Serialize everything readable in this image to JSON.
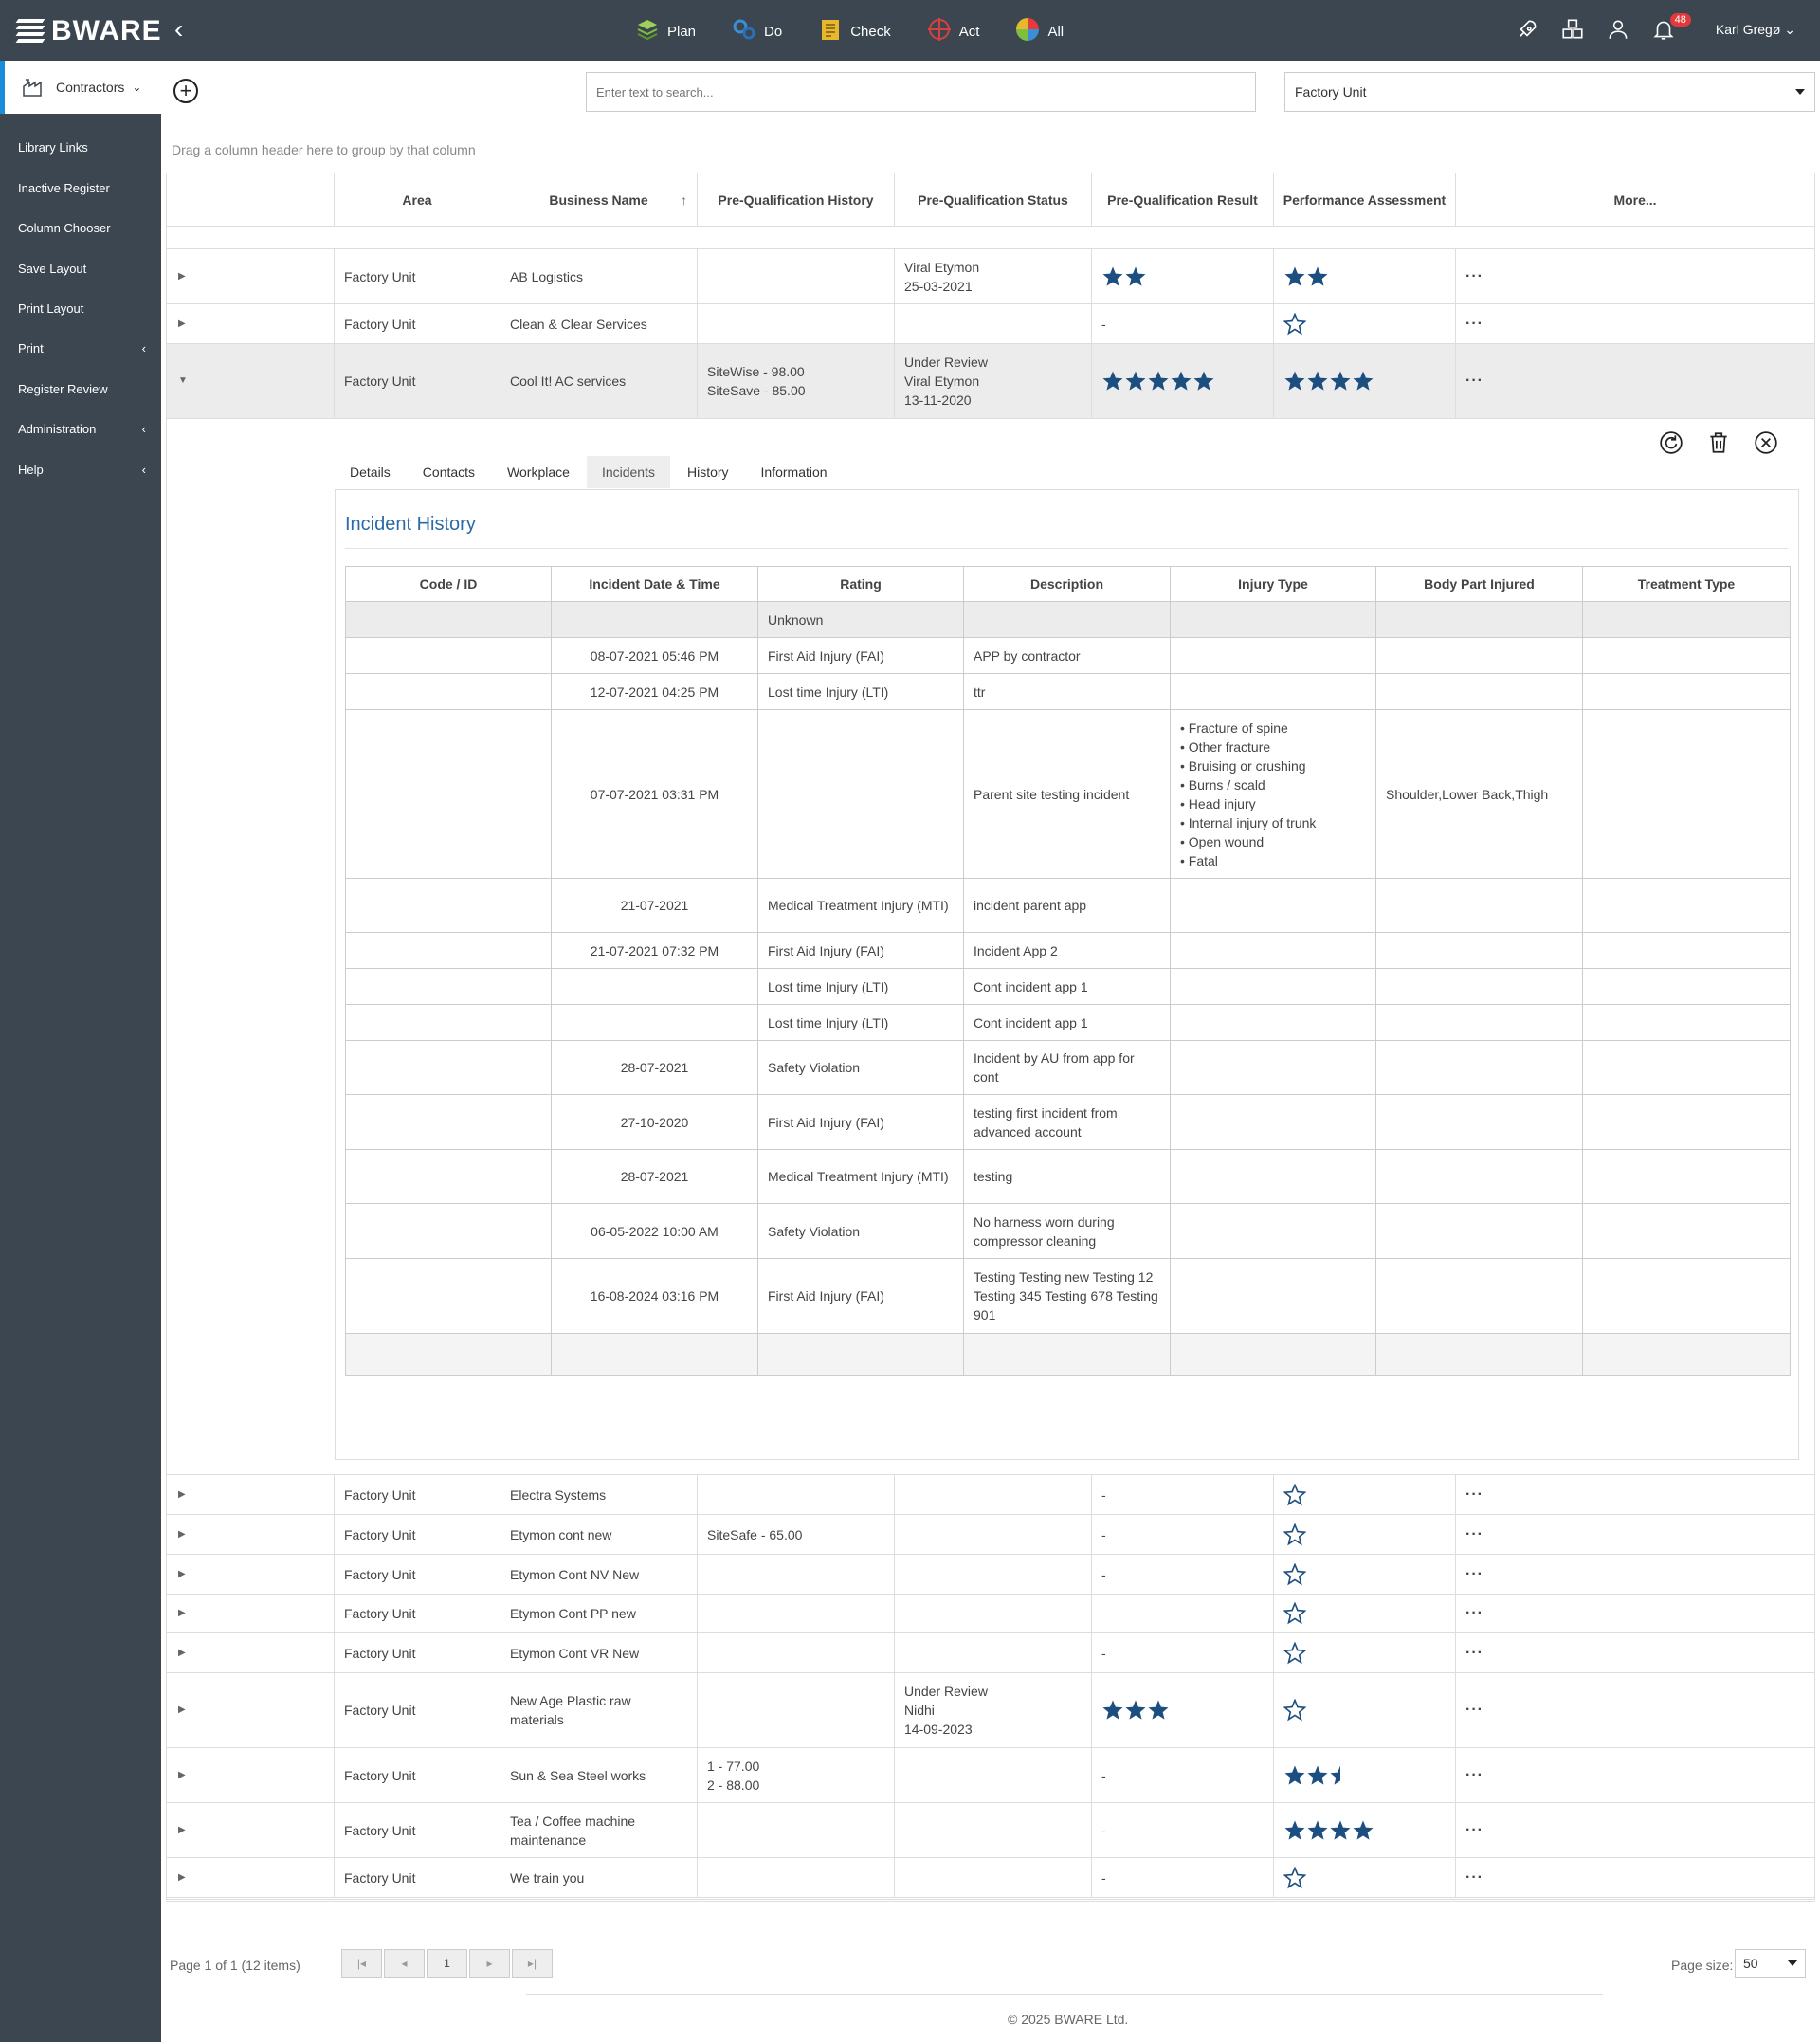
{
  "app": {
    "brand": "BWARE"
  },
  "topnav": {
    "items": [
      {
        "label": "Plan",
        "icon": "plan-icon",
        "color": "#7fbf3f"
      },
      {
        "label": "Do",
        "icon": "do-icon",
        "color": "#3a8fd6"
      },
      {
        "label": "Check",
        "icon": "check-icon",
        "color": "#e6b82e"
      },
      {
        "label": "Act",
        "icon": "act-icon",
        "color": "#d64040"
      },
      {
        "label": "All",
        "icon": "all-icon",
        "color": "#e63a3a"
      }
    ],
    "notifications_count": "48",
    "user_name": "Karl Gregø"
  },
  "sidebar": {
    "active": {
      "label": "Contractors"
    },
    "items": [
      {
        "label": "Library Links",
        "chevron": ""
      },
      {
        "label": "Inactive Register",
        "chevron": ""
      },
      {
        "label": "Column Chooser",
        "chevron": ""
      },
      {
        "label": "Save Layout",
        "chevron": ""
      },
      {
        "label": "Print Layout",
        "chevron": ""
      },
      {
        "label": "Print",
        "chevron": "‹"
      },
      {
        "label": "Register Review",
        "chevron": ""
      },
      {
        "label": "Administration",
        "chevron": "‹"
      },
      {
        "label": "Help",
        "chevron": "‹"
      }
    ]
  },
  "toolbar": {
    "search_placeholder": "Enter text to search...",
    "area_selected": "Factory Unit",
    "group_hint": "Drag a column header here to group by that column"
  },
  "grid": {
    "headers": [
      "",
      "Area",
      "Business Name",
      "Pre-Qualification History",
      "Pre-Qualification Status",
      "Pre-Qualification Result",
      "Performance Assessment",
      "More..."
    ],
    "sort_icon": "↑",
    "rows": [
      {
        "area": "Factory Unit",
        "business": "AB Logistics",
        "history": [],
        "status": [
          "Viral Etymon",
          "25-03-2021"
        ],
        "result_stars": 2,
        "result_text": "",
        "perf_stars": 2,
        "expanded": false
      },
      {
        "area": "Factory Unit",
        "business": "Clean & Clear Services",
        "history": [],
        "status": [],
        "result_stars": 0,
        "result_text": "-",
        "perf_stars": 0,
        "expanded": false
      },
      {
        "area": "Factory Unit",
        "business": "Cool It! AC services",
        "history": [
          "SiteWise - 98.00",
          "SiteSave - 85.00"
        ],
        "status": [
          "Under Review",
          "Viral Etymon",
          "13-11-2020"
        ],
        "result_stars": 5,
        "result_text": "",
        "perf_stars": 4,
        "expanded": true
      }
    ],
    "rows_after": [
      {
        "area": "Factory Unit",
        "business": [
          "Electra Systems"
        ],
        "history": [],
        "status": [],
        "result_stars": 0,
        "result_text": "-",
        "perf_stars": 0,
        "perf_empty": true
      },
      {
        "area": "Factory Unit",
        "business": [
          "Etymon cont new"
        ],
        "history": [
          "SiteSafe - 65.00"
        ],
        "status": [],
        "result_stars": 0,
        "result_text": "-",
        "perf_stars": 0,
        "perf_empty": true
      },
      {
        "area": "Factory Unit",
        "business": [
          "Etymon Cont NV New"
        ],
        "history": [],
        "status": [],
        "result_stars": 0,
        "result_text": "-",
        "perf_stars": 0,
        "perf_empty": true
      },
      {
        "area": "Factory Unit",
        "business": [
          "Etymon Cont PP new"
        ],
        "history": [],
        "status": [],
        "result_stars": 0,
        "result_text": "",
        "perf_stars": 0,
        "perf_empty": true
      },
      {
        "area": "Factory Unit",
        "business": [
          "Etymon Cont VR New"
        ],
        "history": [],
        "status": [],
        "result_stars": 0,
        "result_text": "-",
        "perf_stars": 0,
        "perf_empty": true
      },
      {
        "area": "Factory Unit",
        "business": [
          "New Age Plastic raw",
          "materials"
        ],
        "history": [],
        "status": [
          "Under Review",
          "Nidhi",
          "14-09-2023"
        ],
        "result_stars": 3,
        "result_text": "",
        "perf_stars": 0,
        "perf_empty": true
      },
      {
        "area": "Factory Unit",
        "business": [
          "Sun & Sea Steel works"
        ],
        "history": [
          "1 - 77.00",
          "2 - 88.00"
        ],
        "status": [],
        "result_stars": 0,
        "result_text": "-",
        "perf_stars": 2.5,
        "perf_empty": false
      },
      {
        "area": "Factory Unit",
        "business": [
          "Tea / Coffee machine",
          "maintenance"
        ],
        "history": [],
        "status": [],
        "result_stars": 0,
        "result_text": "-",
        "perf_stars": 4,
        "perf_empty": false
      },
      {
        "area": "Factory Unit",
        "business": [
          "We train you"
        ],
        "history": [],
        "status": [],
        "result_stars": 0,
        "result_text": "-",
        "perf_stars": 0,
        "perf_empty": true
      }
    ]
  },
  "detail": {
    "tabs": [
      "Details",
      "Contacts",
      "Workplace",
      "Incidents",
      "History",
      "Information"
    ],
    "active_tab": "Incidents",
    "section_title": "Incident History",
    "incident_headers": [
      "Code / ID",
      "Incident Date & Time",
      "Rating",
      "Description",
      "Injury Type",
      "Body Part Injured",
      "Treatment Type"
    ],
    "group_label": "Unknown",
    "incidents": [
      {
        "code": "",
        "date": "08-07-2021 05:46 PM",
        "rating": "First Aid Injury (FAI)",
        "description": "APP by contractor",
        "injury": [],
        "body": "",
        "treatment": ""
      },
      {
        "code": "",
        "date": "12-07-2021 04:25 PM",
        "rating": "Lost time Injury (LTI)",
        "description": "ttr",
        "injury": [],
        "body": "",
        "treatment": ""
      },
      {
        "code": "",
        "date": "07-07-2021 03:31 PM",
        "rating": "",
        "description": "Parent site testing incident",
        "injury": [
          "Fracture of spine",
          "Other fracture",
          "Bruising or crushing",
          "Burns / scald",
          "Head injury",
          "Internal injury of trunk",
          "Open wound",
          "Fatal"
        ],
        "body": "Shoulder,Lower Back,Thigh",
        "treatment": ""
      },
      {
        "code": "",
        "date": "21-07-2021",
        "rating": "Medical Treatment Injury (MTI)",
        "description": "incident parent app",
        "injury": [],
        "body": "",
        "treatment": ""
      },
      {
        "code": "",
        "date": "21-07-2021 07:32 PM",
        "rating": "First Aid Injury (FAI)",
        "description": "Incident App 2",
        "injury": [],
        "body": "",
        "treatment": ""
      },
      {
        "code": "",
        "date": "",
        "rating": "Lost time Injury (LTI)",
        "description": "Cont incident app 1",
        "injury": [],
        "body": "",
        "treatment": ""
      },
      {
        "code": "",
        "date": "",
        "rating": "Lost time Injury (LTI)",
        "description": "Cont incident app 1",
        "injury": [],
        "body": "",
        "treatment": ""
      },
      {
        "code": "",
        "date": "28-07-2021",
        "rating": "Safety Violation",
        "description": "Incident by AU from app for cont",
        "injury": [],
        "body": "",
        "treatment": ""
      },
      {
        "code": "",
        "date": "27-10-2020",
        "rating": "First Aid Injury (FAI)",
        "description": "testing first incident from advanced account",
        "injury": [],
        "body": "",
        "treatment": ""
      },
      {
        "code": "",
        "date": "28-07-2021",
        "rating": "Medical Treatment Injury (MTI)",
        "description": "testing",
        "injury": [],
        "body": "",
        "treatment": ""
      },
      {
        "code": "",
        "date": "06-05-2022 10:00 AM",
        "rating": "Safety Violation",
        "description": "No harness worn during compressor cleaning",
        "injury": [],
        "body": "",
        "treatment": ""
      },
      {
        "code": "",
        "date": "16-08-2024 03:16 PM",
        "rating": "First Aid Injury (FAI)",
        "description": "Testing Testing new Testing 12 Testing 345 Testing 678 Testing 901",
        "injury": [],
        "body": "",
        "treatment": ""
      }
    ]
  },
  "pager": {
    "info": "Page 1 of 1 (12 items)",
    "current_page": "1",
    "page_size_label": "Page size:",
    "page_size": "50"
  },
  "footer": {
    "copyright": "© 2025 BWARE Ltd."
  },
  "colors": {
    "star": "#1c4f80",
    "topbar": "#3b4650",
    "accent": "#1a8cd8",
    "title": "#2a6aa8"
  }
}
